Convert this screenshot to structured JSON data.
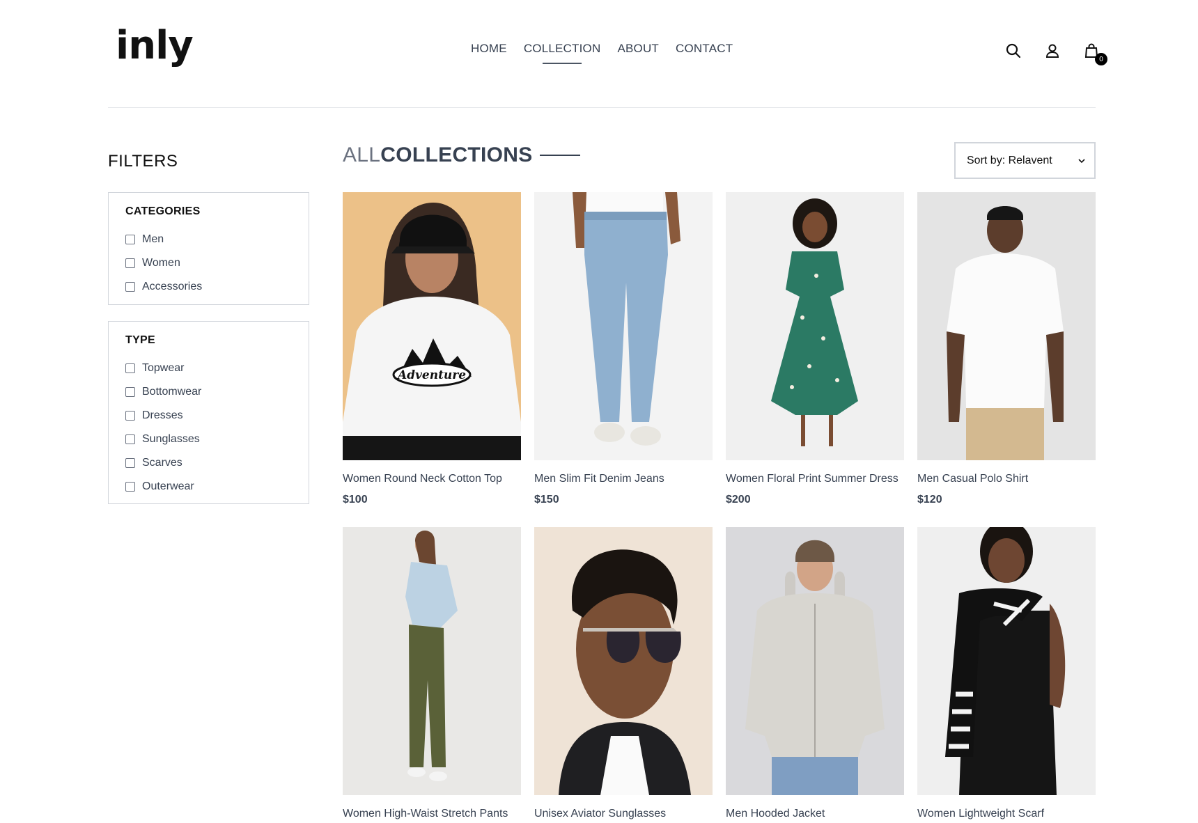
{
  "brand": {
    "logo": "inly"
  },
  "nav": {
    "items": [
      {
        "label": "HOME"
      },
      {
        "label": "COLLECTION"
      },
      {
        "label": "ABOUT"
      },
      {
        "label": "CONTACT"
      }
    ],
    "active": "COLLECTION"
  },
  "header_icons": {
    "search": "search-icon",
    "account": "user-icon",
    "cart": "cart-icon",
    "cart_count": "0"
  },
  "filters": {
    "title": "FILTERS",
    "categories": {
      "heading": "CATEGORIES",
      "options": [
        "Men",
        "Women",
        "Accessories"
      ]
    },
    "type": {
      "heading": "TYPE",
      "options": [
        "Topwear",
        "Bottomwear",
        "Dresses",
        "Sunglasses",
        "Scarves",
        "Outerwear"
      ]
    }
  },
  "collection": {
    "title_prefix": "ALL",
    "title_main": "COLLECTIONS"
  },
  "sort": {
    "label": "Sort by: Relavent"
  },
  "products": [
    {
      "name": "Women Round Neck Cotton Top",
      "price": "$100",
      "bg": "#ecc188"
    },
    {
      "name": "Men Slim Fit Denim Jeans",
      "price": "$150",
      "bg": "#f3f3f3"
    },
    {
      "name": "Women Floral Print Summer Dress",
      "price": "$200",
      "bg": "#f0f0f0"
    },
    {
      "name": "Men Casual Polo Shirt",
      "price": "$120",
      "bg": "#e4e4e4"
    },
    {
      "name": "Women High-Waist Stretch Pants",
      "price": "",
      "bg": "#e9e8e6"
    },
    {
      "name": "Unisex Aviator Sunglasses",
      "price": "",
      "bg": "#efe3d6"
    },
    {
      "name": "Men Hooded Jacket",
      "price": "",
      "bg": "#d9d9dc"
    },
    {
      "name": "Women Lightweight Scarf",
      "price": "",
      "bg": "#efefef"
    }
  ]
}
